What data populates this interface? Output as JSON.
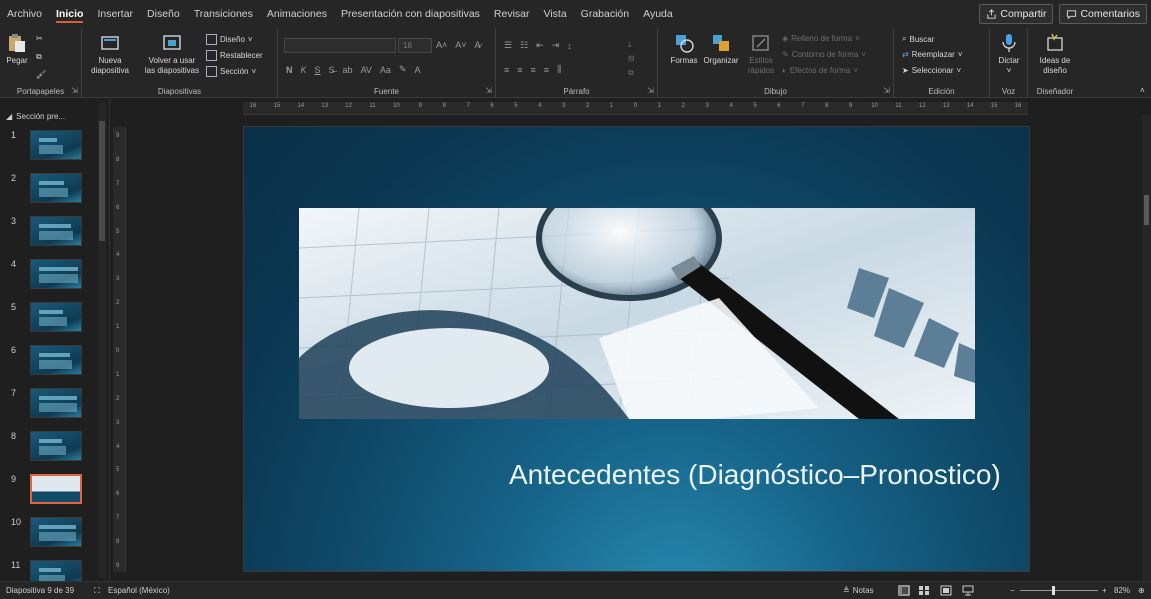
{
  "tabs": [
    "Archivo",
    "Inicio",
    "Insertar",
    "Diseño",
    "Transiciones",
    "Animaciones",
    "Presentación con diapositivas",
    "Revisar",
    "Vista",
    "Grabación",
    "Ayuda"
  ],
  "active_tab": "Inicio",
  "share_label": "Compartir",
  "comments_label": "Comentarios",
  "ribbon": {
    "portapapeles": {
      "label": "Portapapeles",
      "paste": "Pegar"
    },
    "diapositivas": {
      "label": "Diapositivas",
      "new_slide_1": "Nueva",
      "new_slide_2": "diapositiva",
      "reuse_1": "Volver a usar",
      "reuse_2": "las diapositivas",
      "layout": "Diseño",
      "reset": "Restablecer",
      "section": "Sección"
    },
    "fuente": {
      "label": "Fuente",
      "size": "18"
    },
    "parrafo": {
      "label": "Párrafo"
    },
    "dibujo": {
      "label": "Dibujo",
      "shapes": "Formas",
      "arrange": "Organizar",
      "quick_styles_1": "Estilos",
      "quick_styles_2": "rápidos",
      "shape_fill": "Relleno de forma",
      "shape_outline": "Contorno de forma",
      "shape_effects": "Efectos de forma"
    },
    "edicion": {
      "label": "Edición",
      "find": "Buscar",
      "replace": "Reemplazar",
      "select": "Seleccionar"
    },
    "voz": {
      "label": "Voz",
      "dictate": "Dictar"
    },
    "disenador": {
      "label": "Diseñador",
      "ideas_1": "Ideas de",
      "ideas_2": "diseño"
    }
  },
  "thumbnails": {
    "section_name": "Sección pre...",
    "numbers": [
      "1",
      "2",
      "3",
      "4",
      "5",
      "6",
      "7",
      "8",
      "9",
      "10",
      "11"
    ],
    "selected": "9"
  },
  "ruler_h": [
    "16",
    "15",
    "14",
    "13",
    "12",
    "11",
    "10",
    "9",
    "8",
    "7",
    "6",
    "5",
    "4",
    "3",
    "2",
    "1",
    "0",
    "1",
    "2",
    "3",
    "4",
    "5",
    "6",
    "7",
    "8",
    "9",
    "10",
    "11",
    "12",
    "13",
    "14",
    "15",
    "16"
  ],
  "ruler_v": [
    "9",
    "8",
    "7",
    "6",
    "5",
    "4",
    "3",
    "2",
    "1",
    "0",
    "1",
    "2",
    "3",
    "4",
    "5",
    "6",
    "7",
    "8",
    "9"
  ],
  "slide": {
    "title": "Antecedentes (Diagnóstico–Pronostico)"
  },
  "status": {
    "slide_counter": "Diapositiva 9 de 39",
    "language": "Español (México)",
    "notes": "Notas",
    "zoom": "82%"
  },
  "colors": {
    "accent": "#e05a3a",
    "slide_bg": "#0f4a68",
    "ribbon_bg": "#262626"
  }
}
